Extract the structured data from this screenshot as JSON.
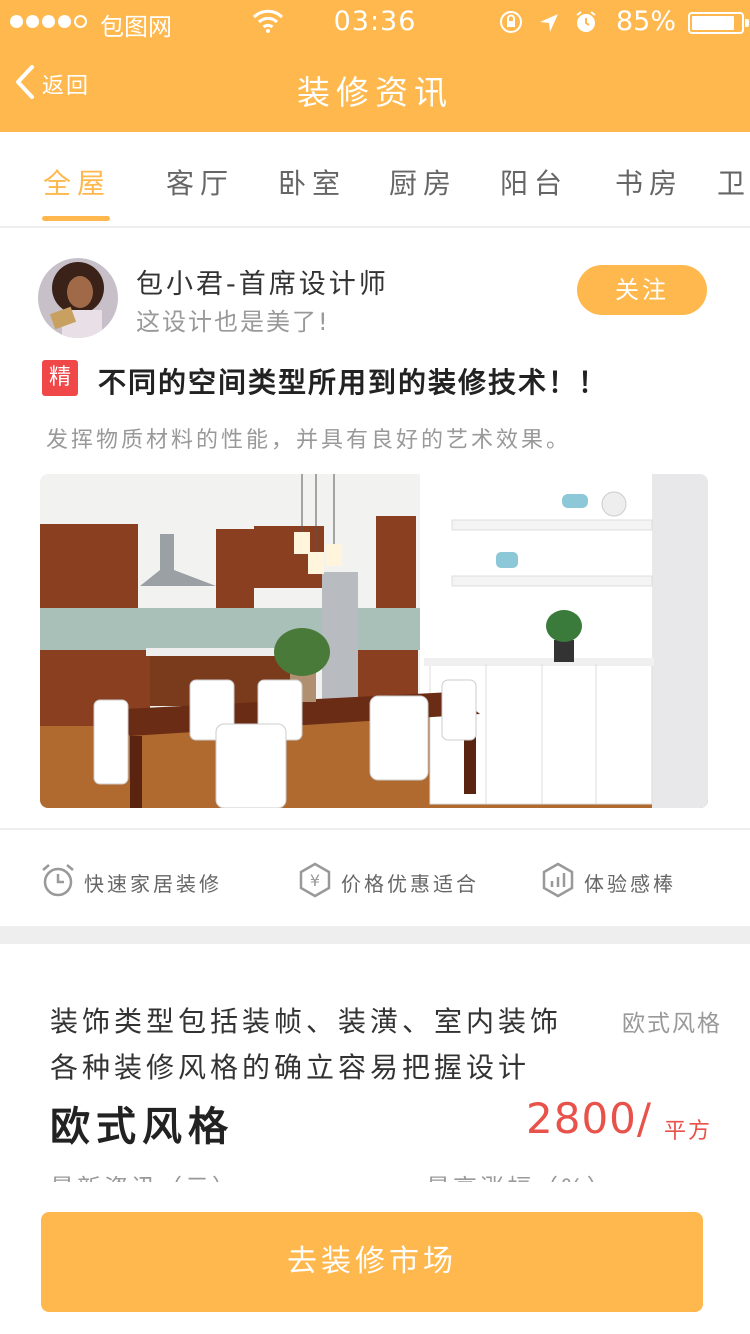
{
  "status_bar": {
    "carrier": "包图网",
    "time": "03:36",
    "battery": "85%"
  },
  "nav": {
    "back_label": "返回",
    "title": "装修资讯"
  },
  "tabs": [
    {
      "label": "全屋",
      "active": true
    },
    {
      "label": "客厅",
      "active": false
    },
    {
      "label": "卧室",
      "active": false
    },
    {
      "label": "厨房",
      "active": false
    },
    {
      "label": "阳台",
      "active": false
    },
    {
      "label": "书房",
      "active": false
    },
    {
      "label": "卫生间",
      "active": false
    }
  ],
  "post": {
    "author_name": "包小君-首席设计师",
    "author_desc": "这设计也是美了!",
    "follow_label": "关注",
    "badge": "精",
    "title": "不同的空间类型所用到的装修技术！！",
    "summary": "发挥物质材料的性能，并具有良好的艺术效果。"
  },
  "features": [
    {
      "icon": "alarm-clock-icon",
      "label": "快速家居装修"
    },
    {
      "icon": "yen-shield-icon",
      "label": "价格优惠适合"
    },
    {
      "icon": "chart-shield-icon",
      "label": "体验感棒"
    }
  ],
  "style_card": {
    "desc_line1": "装饰类型包括装帧、装潢、室内装饰",
    "tag": "欧式风格",
    "desc_line2": "各种装修风格的确立容易把握设计",
    "name": "欧式风格",
    "price": "2800/",
    "price_unit": "平方",
    "cut_left": "最新资讯（元）",
    "cut_right": "最高涨幅（%）"
  },
  "cta_label": "去装修市场",
  "colors": {
    "accent": "#ffb84d",
    "price": "#e8524a",
    "badge": "#f04848"
  }
}
